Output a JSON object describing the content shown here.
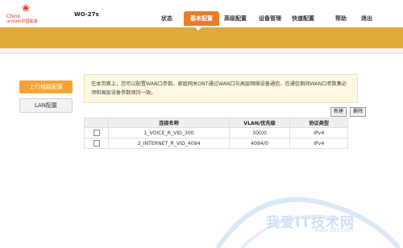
{
  "header": {
    "logo_cn": "Chino",
    "logo_en": "unicom中国联通",
    "model": "WO-27s",
    "nav": [
      {
        "label": "状态",
        "active": false
      },
      {
        "label": "基本配置",
        "active": true
      },
      {
        "label": "高级配置",
        "active": false
      },
      {
        "label": "设备管理",
        "active": false
      },
      {
        "label": "快速配置",
        "active": false
      },
      {
        "label": "帮助",
        "active": false
      },
      {
        "label": "退出",
        "active": false
      }
    ]
  },
  "sidebar": {
    "items": [
      {
        "label": "上行线路配置",
        "active": true
      },
      {
        "label": "LAN配置",
        "active": false
      }
    ]
  },
  "notice": {
    "text": "在本页面上，您可以配置WAN口参数。家庭网关ONT通过WAN口与高层网络设备通信，在通信期间WAN口参数集必须和高层设备参数保持一致。"
  },
  "toolbar": {
    "new_label": "新建",
    "delete_label": "删除"
  },
  "table": {
    "headers": [
      "",
      "连接名称",
      "VLAN/优先级",
      "协议类型"
    ],
    "rows": [
      {
        "name": "1_VOICE_R_VID_300",
        "vlan": "300/0",
        "protocol": "IPv4"
      },
      {
        "name": "2_INTERNET_R_VID_4094",
        "vlan": "4094/0",
        "protocol": "IPv4"
      }
    ]
  },
  "watermark": {
    "text": "我爱IT技术网",
    "url": "www.52ij.com"
  },
  "colors": {
    "accent": "#e97c2b",
    "bar": "#e0a93a",
    "brand": "#d52b1e"
  }
}
